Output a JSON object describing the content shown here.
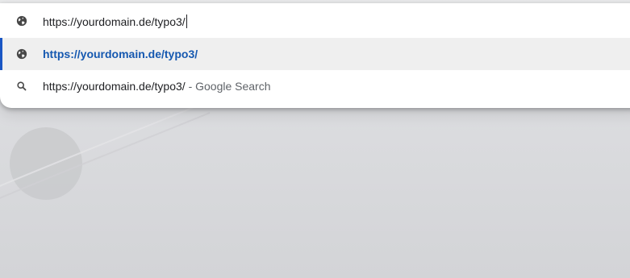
{
  "omnibox": {
    "input_value": "https://yourdomain.de/typo3/",
    "input_icon": "globe-icon",
    "suggestions": [
      {
        "icon": "globe-icon",
        "text": "https://yourdomain.de/typo3/",
        "selected": true
      },
      {
        "icon": "search-icon",
        "text": "https://yourdomain.de/typo3/",
        "suffix": "- Google Search",
        "selected": false
      }
    ]
  },
  "colors": {
    "accent": "#1a56c4",
    "link_text": "#1558b0",
    "selected_row_bg": "#efefef"
  }
}
